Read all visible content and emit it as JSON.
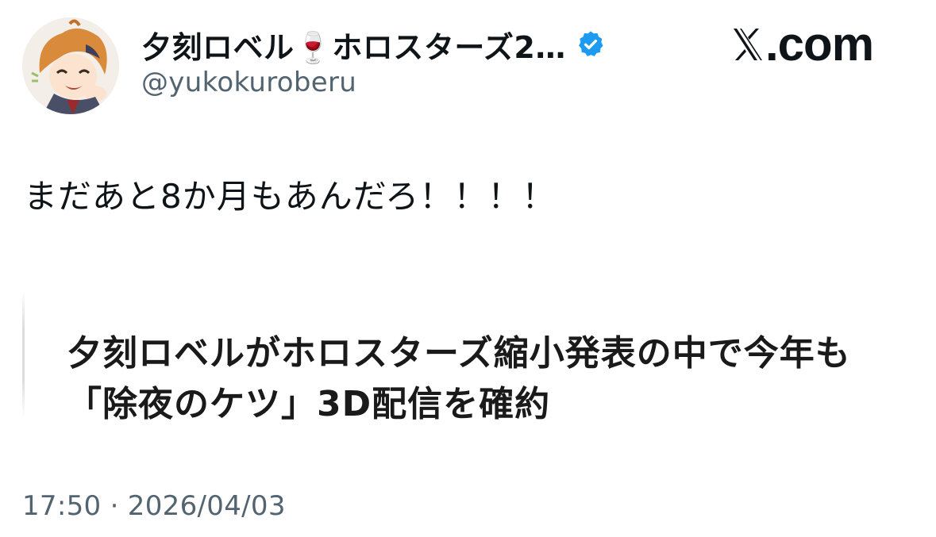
{
  "author": {
    "display_name": "夕刻ロベル🍷ホロスターズ2…",
    "handle": "@yukokuroberu",
    "verified": true,
    "verified_color": "#1d9bf0"
  },
  "brand": {
    "logo_icon": "x-logo-icon",
    "text": ".com"
  },
  "tweet": {
    "text": "まだあと8か月もあんだろ！！！！",
    "timestamp": "17:50 · 2026/04/03"
  },
  "quoted_card": {
    "headline": "夕刻ロベルがホロスターズ縮小発表の中で今年も「除夜のケツ」3D配信を確約"
  },
  "colors": {
    "text_primary": "#0f1419",
    "text_secondary": "#536471",
    "accent": "#1d9bf0"
  }
}
